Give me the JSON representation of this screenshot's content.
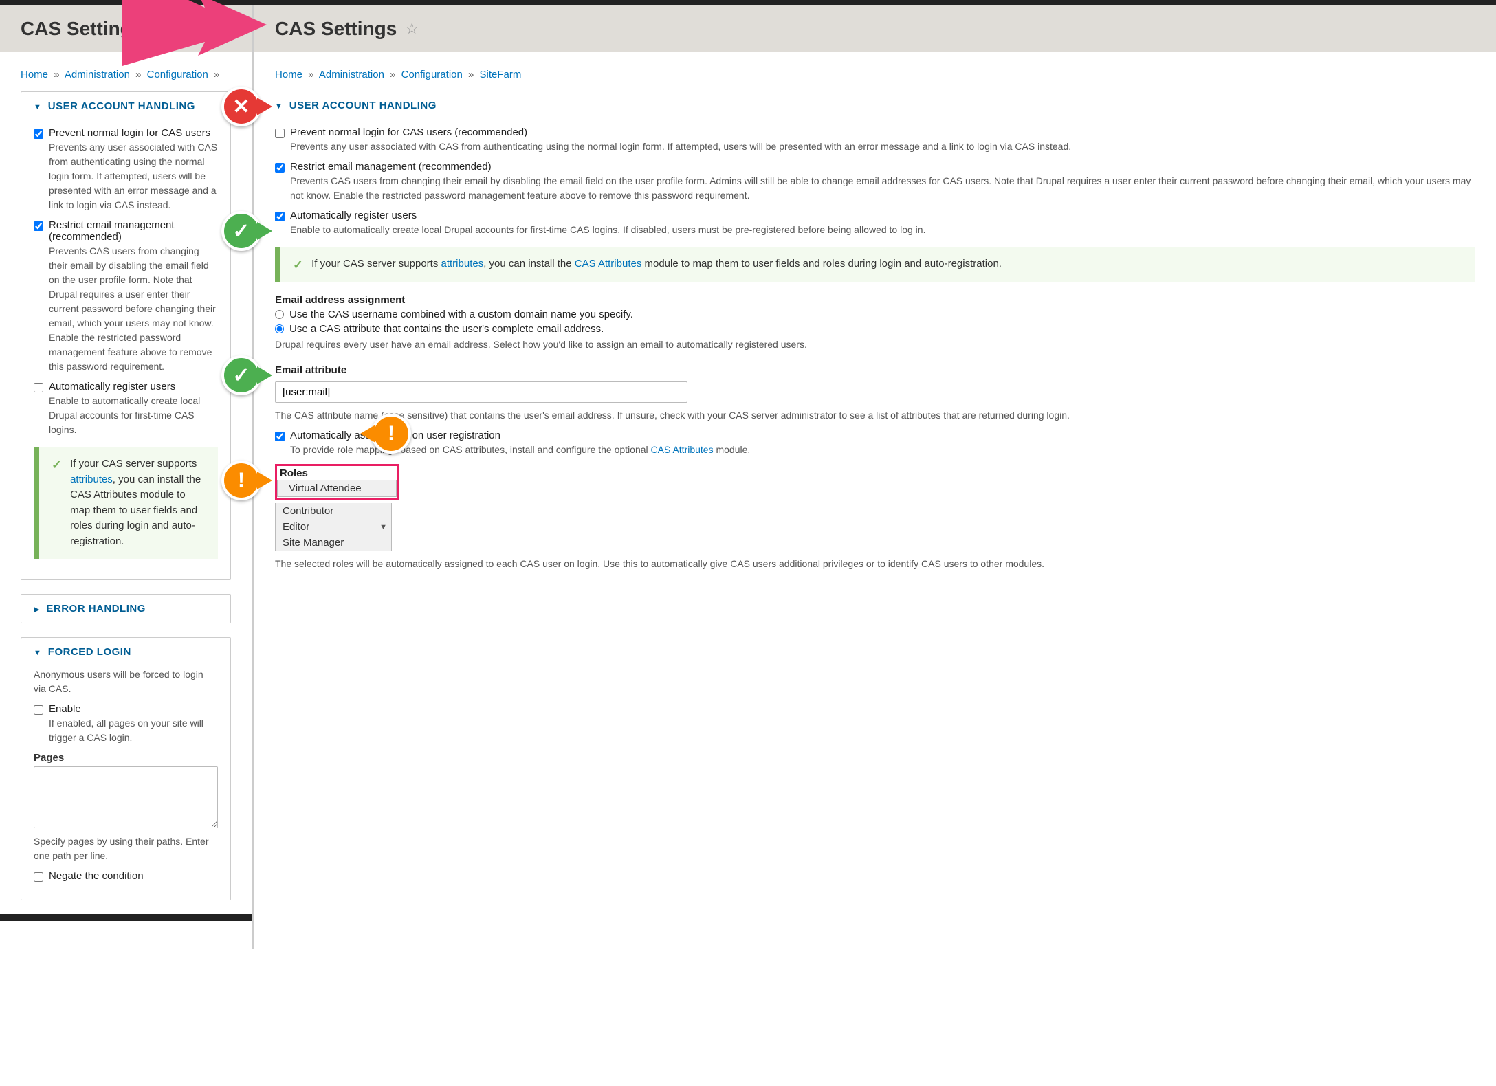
{
  "left": {
    "title": "CAS Settings",
    "breadcrumb": {
      "home": "Home",
      "admin": "Administration",
      "config": "Configuration"
    },
    "section_user": "USER ACCOUNT HANDLING",
    "prevent_label": "Prevent normal login for CAS users",
    "prevent_desc": "Prevents any user associated with CAS from authenticating using the normal login form. If attempted, users will be presented with an error message and a link to login via CAS instead.",
    "restrict_label": "Restrict email management (recommended)",
    "restrict_desc": "Prevents CAS users from changing their email by disabling the email field on the user profile form. Note that Drupal requires a user enter their current password before changing their email, which your users may not know. Enable the restricted password management feature above to remove this password requirement.",
    "auto_label": "Automatically register users",
    "auto_desc": "Enable to automatically create local Drupal accounts for first-time CAS logins.",
    "callout_prefix": "If your CAS server supports ",
    "callout_link": "attributes",
    "callout_suffix": ", you can install the CAS Attributes module to map them to user fields and roles during login and auto-registration.",
    "section_error": "ERROR HANDLING",
    "section_forced": "FORCED LOGIN",
    "forced_desc": "Anonymous users will be forced to login via CAS.",
    "enable_label": "Enable",
    "enable_desc": "If enabled, all pages on your site will trigger a CAS login.",
    "pages_label": "Pages",
    "pages_help": "Specify pages by using their paths. Enter one path per line.",
    "negate_label": "Negate the condition"
  },
  "right": {
    "title": "CAS Settings",
    "breadcrumb": {
      "home": "Home",
      "admin": "Administration",
      "config": "Configuration",
      "sitefarm": "SiteFarm"
    },
    "section_user": "USER ACCOUNT HANDLING",
    "prevent_label": "Prevent normal login for CAS users (recommended)",
    "prevent_desc": "Prevents any user associated with CAS from authenticating using the normal login form. If attempted, users will be presented with an error message and a link to login via CAS instead.",
    "restrict_label": "Restrict email management (recommended)",
    "restrict_desc": "Prevents CAS users from changing their email by disabling the email field on the user profile form. Admins will still be able to change email addresses for CAS users. Note that Drupal requires a user enter their current password before changing their email, which your users may not know. Enable the restricted password management feature above to remove this password requirement.",
    "auto_label": "Automatically register users",
    "auto_desc": "Enable to automatically create local Drupal accounts for first-time CAS logins. If disabled, users must be pre-registered before being allowed to log in.",
    "callout_prefix": "If your CAS server supports ",
    "callout_link1": "attributes",
    "callout_mid": ", you can install the ",
    "callout_link2": "CAS Attributes",
    "callout_suffix": " module to map them to user fields and roles during login and auto-registration.",
    "email_assign_heading": "Email address assignment",
    "radio1": "Use the CAS username combined with a custom domain name you specify.",
    "radio2": "Use a CAS attribute that contains the user's complete email address.",
    "email_assign_help": "Drupal requires every user have an email address. Select how you'd like to assign an email to automatically registered users.",
    "email_attr_heading": "Email attribute",
    "email_attr_value": "[user:mail]",
    "email_attr_help": "The CAS attribute name (case sensitive) that contains the user's email address. If unsure, check with your CAS server administrator to see a list of attributes that are returned during login.",
    "auto_roles_label": "Automatically assign roles on user registration",
    "auto_roles_desc_pre": "To provide role mappings based on CAS attributes, install and configure the optional ",
    "auto_roles_desc_link": "CAS Attributes",
    "auto_roles_desc_post": " module.",
    "roles_heading": "Roles",
    "roles": {
      "r0": "Virtual Attendee",
      "r1": "Contributor",
      "r2": "Editor",
      "r3": "Site Manager"
    },
    "roles_help": "The selected roles will be automatically assigned to each CAS user on login. Use this to automatically give CAS users additional privileges or to identify CAS users to other modules."
  }
}
